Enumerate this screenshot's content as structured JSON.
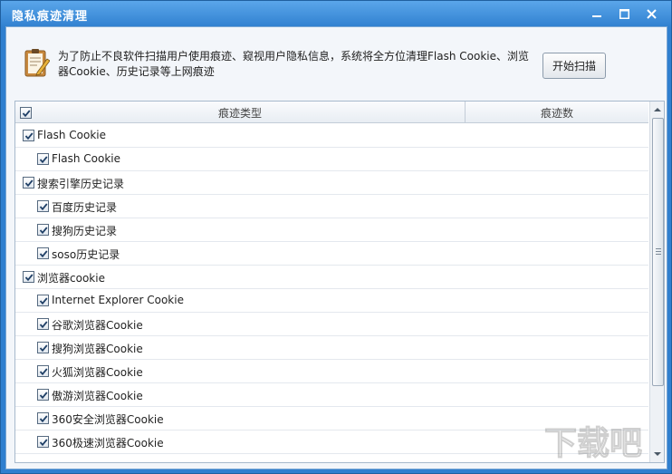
{
  "window": {
    "title": "隐私痕迹清理"
  },
  "info": {
    "text": "为了防止不良软件扫描用户使用痕迹、窥视用户隐私信息，系统将全方位清理Flash Cookie、浏览器Cookie、历史记录等上网痕迹",
    "icon": "document-edit-icon"
  },
  "actions": {
    "scan_label": "开始扫描"
  },
  "table": {
    "columns": [
      "痕迹类型",
      "痕迹数"
    ],
    "header_checked": true,
    "rows": [
      {
        "label": "Flash Cookie",
        "level": 0,
        "checked": true
      },
      {
        "label": "Flash Cookie",
        "level": 1,
        "checked": true
      },
      {
        "label": "搜索引擎历史记录",
        "level": 0,
        "checked": true
      },
      {
        "label": "百度历史记录",
        "level": 1,
        "checked": true
      },
      {
        "label": "搜狗历史记录",
        "level": 1,
        "checked": true
      },
      {
        "label": "soso历史记录",
        "level": 1,
        "checked": true
      },
      {
        "label": "浏览器cookie",
        "level": 0,
        "checked": true
      },
      {
        "label": "Internet Explorer Cookie",
        "level": 1,
        "checked": true
      },
      {
        "label": "谷歌浏览器Cookie",
        "level": 1,
        "checked": true
      },
      {
        "label": "搜狗浏览器Cookie",
        "level": 1,
        "checked": true
      },
      {
        "label": "火狐浏览器Cookie",
        "level": 1,
        "checked": true
      },
      {
        "label": "傲游浏览器Cookie",
        "level": 1,
        "checked": true
      },
      {
        "label": "360安全浏览器Cookie",
        "level": 1,
        "checked": true
      },
      {
        "label": "360极速浏览器Cookie",
        "level": 1,
        "checked": true
      }
    ]
  },
  "watermark": {
    "text": "下载吧",
    "icon": "watermark-logo"
  },
  "colors": {
    "titlebar": "#2f7fcf",
    "client_bg": "#f3f6fa"
  }
}
